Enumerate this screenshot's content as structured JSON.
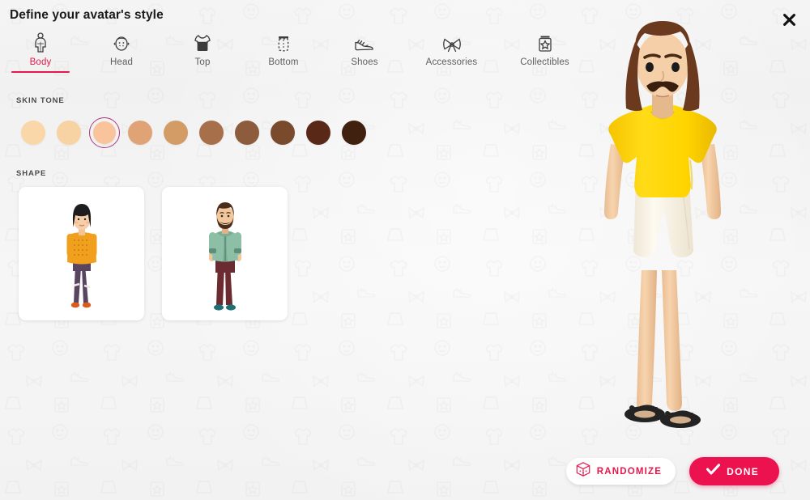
{
  "header": {
    "title": "Define your avatar's style",
    "close_icon": "close-icon"
  },
  "tabs": [
    {
      "label": "Body",
      "icon": "body-icon",
      "active": true
    },
    {
      "label": "Head",
      "icon": "head-icon",
      "active": false
    },
    {
      "label": "Top",
      "icon": "top-shirt-icon",
      "active": false
    },
    {
      "label": "Bottom",
      "icon": "bottom-skirt-icon",
      "active": false
    },
    {
      "label": "Shoes",
      "icon": "shoe-icon",
      "active": false
    },
    {
      "label": "Accessories",
      "icon": "bow-icon",
      "active": false
    },
    {
      "label": "Collectibles",
      "icon": "badge-jar-icon",
      "active": false
    }
  ],
  "skin_tone": {
    "label": "SKIN TONE",
    "selected_index": 2,
    "selected_ring_color": "#a83a7a",
    "swatches": [
      {
        "name": "skin-tone-1",
        "color": "#f9d7a8"
      },
      {
        "name": "skin-tone-2",
        "color": "#f7d3a3"
      },
      {
        "name": "skin-tone-3",
        "color": "#f9c49b"
      },
      {
        "name": "skin-tone-4",
        "color": "#e0a376"
      },
      {
        "name": "skin-tone-5",
        "color": "#d39b65"
      },
      {
        "name": "skin-tone-6",
        "color": "#a8704a"
      },
      {
        "name": "skin-tone-7",
        "color": "#8c5c3c"
      },
      {
        "name": "skin-tone-8",
        "color": "#7a4a2c"
      },
      {
        "name": "skin-tone-9",
        "color": "#5a2816"
      },
      {
        "name": "skin-tone-10",
        "color": "#40200f"
      }
    ]
  },
  "shape": {
    "label": "SHAPE",
    "options": [
      {
        "name": "shape-option-feminine",
        "hair": "#1d1d1f",
        "skin": "#f6cfa9",
        "top": "#f0a01c",
        "bottom": "#5a4560",
        "shoes": "#d95b1e"
      },
      {
        "name": "shape-option-masculine",
        "hair": "#4a2d1c",
        "skin": "#f2c79c",
        "top": "#8cbfa6",
        "inner": "#c0392b",
        "bottom": "#6b2b30",
        "shoes": "#1f6f74"
      }
    ]
  },
  "avatar_preview": {
    "name": "avatar-preview-figure",
    "hair_color": "#6b3a1e",
    "skin_color": "#f5cfa8",
    "shirt_color": "#ffd400",
    "shorts_color": "#fbf7ec",
    "sandal_color": "#232323",
    "mustache_color": "#3a1e0e"
  },
  "actions": {
    "randomize_label": "RANDOMIZE",
    "randomize_icon": "dice-icon",
    "randomize_text_color": "#e8174c",
    "done_label": "DONE",
    "done_icon": "check-icon",
    "done_color": "#ec1250"
  }
}
